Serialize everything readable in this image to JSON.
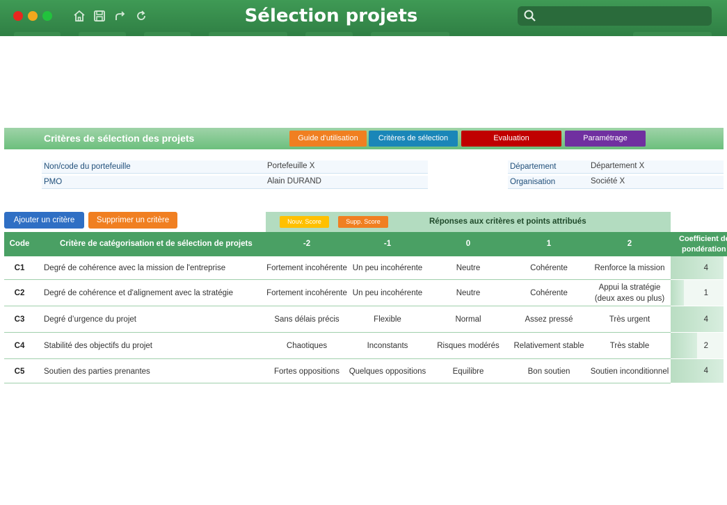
{
  "window": {
    "title": "Sélection projets"
  },
  "header": {
    "title": "Critères de sélection des projets",
    "buttons": [
      {
        "label": "Guide d'utilisation",
        "color": "#f07f21"
      },
      {
        "label": "Critères de sélection",
        "color": "#1a86b8"
      },
      {
        "label": "Evaluation",
        "color": "#c00000"
      },
      {
        "label": "Paramétrage",
        "color": "#7030a0"
      }
    ]
  },
  "info": {
    "portfolio_label": "Non/code du portefeuille",
    "portfolio_value": "Portefeuille X",
    "pmo_label": "PMO",
    "pmo_value": "Alain DURAND",
    "department_label": "Département",
    "department_value": "Département X",
    "organisation_label": "Organisation",
    "organisation_value": "Société X"
  },
  "actions": {
    "add_label": "Ajouter un critère",
    "remove_label": "Supprimer un critère",
    "new_score_label": "Nouv. Score",
    "delete_score_label": "Supp. Score",
    "responses_title": "Réponses aux critères et points attribués"
  },
  "table": {
    "headers": {
      "code": "Code",
      "criterion": "Critère de catégorisation et de sélection de projets",
      "s_m2": "-2",
      "s_m1": "-1",
      "s_0": "0",
      "s_1": "1",
      "s_2": "2",
      "coef_line1": "Coefficient de",
      "coef_line2": "pondération"
    },
    "rows": [
      {
        "code": "C1",
        "criterion": "Degré de cohérence avec la mission de l'entreprise",
        "m2": "Fortement incohérente",
        "m1": "Un peu incohérente",
        "z": "Neutre",
        "p1": "Cohérente",
        "p2": "Renforce la mission",
        "coef": "4",
        "coef_fraction": 1.0
      },
      {
        "code": "C2",
        "criterion": "Degré de cohérence et d'alignement avec la stratégie",
        "m2": "Fortement incohérente",
        "m1": "Un peu incohérente",
        "z": "Neutre",
        "p1": "Cohérente",
        "p2": "Appui la stratégie (deux axes ou plus)",
        "coef": "1",
        "coef_fraction": 0.25
      },
      {
        "code": "C3",
        "criterion": "Degré d’urgence du projet",
        "m2": "Sans délais précis",
        "m1": "Flexible",
        "z": "Normal",
        "p1": "Assez pressé",
        "p2": "Très urgent",
        "coef": "4",
        "coef_fraction": 1.0
      },
      {
        "code": "C4",
        "criterion": "Stabilité des objectifs du projet",
        "m2": "Chaotiques",
        "m1": "Inconstants",
        "z": "Risques modérés",
        "p1": "Relativement stable",
        "p2": "Très stable",
        "coef": "2",
        "coef_fraction": 0.5
      },
      {
        "code": "C5",
        "criterion": "Soutien des parties prenantes",
        "m2": "Fortes oppositions",
        "m1": "Quelques oppositions",
        "z": "Equilibre",
        "p1": "Bon soutien",
        "p2": "Soutien inconditionnel",
        "coef": "4",
        "coef_fraction": 1.0
      }
    ]
  }
}
